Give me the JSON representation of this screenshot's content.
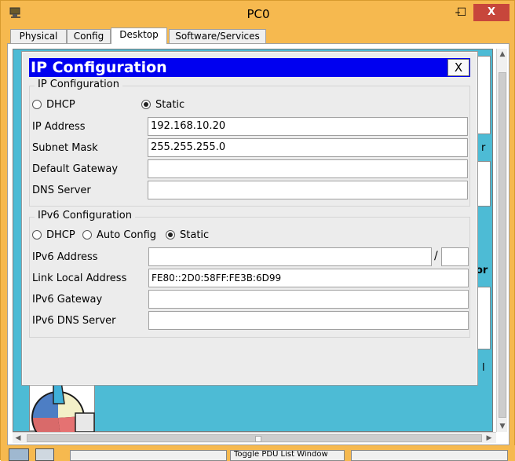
{
  "window": {
    "title": "PC0",
    "controls": {
      "minimize": "–",
      "maximize": "☐",
      "close": "X"
    }
  },
  "tabs": [
    {
      "label": "Physical",
      "active": false
    },
    {
      "label": "Config",
      "active": false
    },
    {
      "label": "Desktop",
      "active": true
    },
    {
      "label": "Software/Services",
      "active": false
    }
  ],
  "background_snippets": {
    "right_r": "r",
    "right_or": "or",
    "right_l": "l",
    "bottom_text": "Toggle PDU List Window"
  },
  "dialog": {
    "title": "IP Configuration",
    "close_label": "X",
    "ipv4": {
      "group_title": "IP Configuration",
      "dhcp_label": "DHCP",
      "static_label": "Static",
      "selected_mode": "Static",
      "fields": {
        "ip_address": {
          "label": "IP Address",
          "value": "192.168.10.20"
        },
        "subnet_mask": {
          "label": "Subnet Mask",
          "value": "255.255.255.0"
        },
        "default_gateway": {
          "label": "Default Gateway",
          "value": ""
        },
        "dns_server": {
          "label": "DNS Server",
          "value": ""
        }
      }
    },
    "ipv6": {
      "group_title": "IPv6 Configuration",
      "dhcp_label": "DHCP",
      "auto_label": "Auto Config",
      "static_label": "Static",
      "selected_mode": "Static",
      "fields": {
        "ipv6_address": {
          "label": "IPv6 Address",
          "value": "",
          "prefix": ""
        },
        "prefix_separator": "/",
        "link_local": {
          "label": "Link Local Address",
          "value": "FE80::2D0:58FF:FE3B:6D99"
        },
        "ipv6_gateway": {
          "label": "IPv6 Gateway",
          "value": ""
        },
        "ipv6_dns": {
          "label": "IPv6 DNS Server",
          "value": ""
        }
      }
    }
  },
  "colors": {
    "window_frame": "#f6b94f",
    "close_button": "#c7463b",
    "desktop_bg": "#4dbbd5",
    "dialog_title_bar": "#0000f0"
  }
}
